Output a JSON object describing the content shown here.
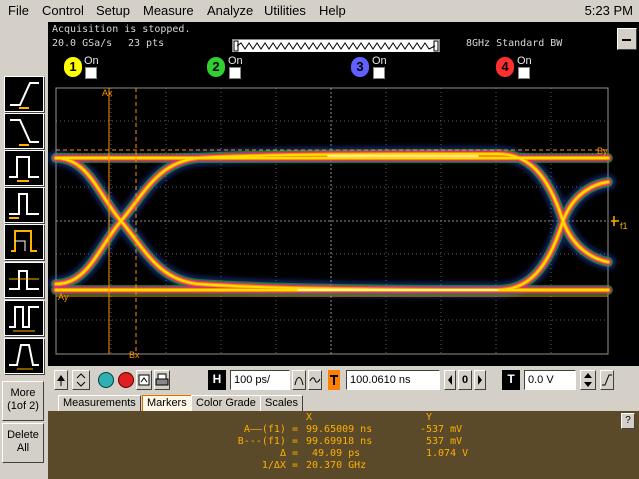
{
  "menu": {
    "items": [
      "File",
      "Control",
      "Setup",
      "Measure",
      "Analyze",
      "Utilities",
      "Help"
    ],
    "clock": "5:23 PM"
  },
  "status": {
    "acquisition": "Acquisition is stopped.",
    "rate": "20.0 GSa/s",
    "points": "23 pts",
    "bandwidth": "8GHz Standard BW"
  },
  "channels": [
    {
      "number": "1",
      "label": "On",
      "color": "#ffff00"
    },
    {
      "number": "2",
      "label": "On",
      "color": "#30d030"
    },
    {
      "number": "3",
      "label": "On",
      "color": "#6060ff"
    },
    {
      "number": "4",
      "label": "On",
      "color": "#ff3030"
    }
  ],
  "left_toolbar": {
    "more_label": "More",
    "more_sub": "(1of 2)",
    "delete_label": "Delete",
    "all_label": "All"
  },
  "markers_on_screen": {
    "ax": "Ax",
    "bx": "Bx",
    "by": "By",
    "ay": "Ay",
    "f1": "f1"
  },
  "controls": {
    "horizontal_label": "H",
    "timebase": "100 ps/",
    "position": "100.0610 ns",
    "trigger_label": "T",
    "trigger_level": "0.0 V",
    "position_zero": "0"
  },
  "tabs": [
    "Measurements",
    "Markers",
    "Color Grade",
    "Scales"
  ],
  "active_tab": "Markers",
  "marker_panel": {
    "col_x": "X",
    "col_y": "Y",
    "help": "?",
    "rows": [
      {
        "label": "A——(f1) =",
        "x": "99.65009 ns",
        "y": "-537 mV"
      },
      {
        "label": "B---(f1) =",
        "x": "99.69918 ns",
        "y": "537 mV"
      },
      {
        "label": "Δ =",
        "x": "49.09 ps",
        "y": "1.074 V"
      },
      {
        "label": "1/ΔX =",
        "x": "20.370 GHz",
        "y": ""
      }
    ]
  }
}
